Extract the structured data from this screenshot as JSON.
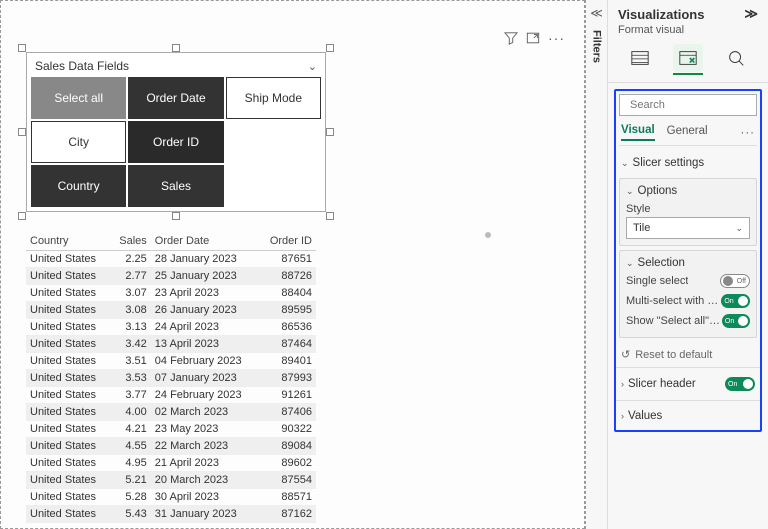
{
  "slicer": {
    "title": "Sales Data Fields",
    "tiles": [
      {
        "label": "Select all",
        "style": "gray"
      },
      {
        "label": "Order Date",
        "style": "dark"
      },
      {
        "label": "Ship Mode",
        "style": "light"
      },
      {
        "label": "City",
        "style": "light"
      },
      {
        "label": "Order ID",
        "style": "darker"
      },
      {
        "label": "",
        "style": "empty"
      },
      {
        "label": "Country",
        "style": "dark"
      },
      {
        "label": "Sales",
        "style": "dark"
      }
    ]
  },
  "table": {
    "headers": [
      "Country",
      "Sales",
      "Order Date",
      "Order ID"
    ],
    "rows": [
      [
        "United States",
        "2.25",
        "28 January 2023",
        "87651"
      ],
      [
        "United States",
        "2.77",
        "25 January 2023",
        "88726"
      ],
      [
        "United States",
        "3.07",
        "23 April 2023",
        "88404"
      ],
      [
        "United States",
        "3.08",
        "26 January 2023",
        "89595"
      ],
      [
        "United States",
        "3.13",
        "24 April 2023",
        "86536"
      ],
      [
        "United States",
        "3.42",
        "13 April 2023",
        "87464"
      ],
      [
        "United States",
        "3.51",
        "04 February 2023",
        "89401"
      ],
      [
        "United States",
        "3.53",
        "07 January 2023",
        "87993"
      ],
      [
        "United States",
        "3.77",
        "24 February 2023",
        "91261"
      ],
      [
        "United States",
        "4.00",
        "02 March 2023",
        "87406"
      ],
      [
        "United States",
        "4.21",
        "23 May 2023",
        "90322"
      ],
      [
        "United States",
        "4.55",
        "22 March 2023",
        "89084"
      ],
      [
        "United States",
        "4.95",
        "21 April 2023",
        "89602"
      ],
      [
        "United States",
        "5.21",
        "20 March 2023",
        "87554"
      ],
      [
        "United States",
        "5.28",
        "30 April 2023",
        "88571"
      ],
      [
        "United States",
        "5.43",
        "31 January 2023",
        "87162"
      ]
    ]
  },
  "filters_label": "Filters",
  "viz": {
    "title": "Visualizations",
    "subtitle": "Format visual",
    "search_placeholder": "Search",
    "tabs": {
      "visual": "Visual",
      "general": "General"
    },
    "slicer_settings": "Slicer settings",
    "options": {
      "heading": "Options",
      "style_label": "Style",
      "style_value": "Tile"
    },
    "selection": {
      "heading": "Selection",
      "single_select": "Single select",
      "multi_select": "Multi-select with C…",
      "show_all": "Show \"Select all\" o…",
      "on": "On",
      "off": "Off"
    },
    "reset": "Reset to default",
    "slicer_header": "Slicer header",
    "values": "Values"
  }
}
